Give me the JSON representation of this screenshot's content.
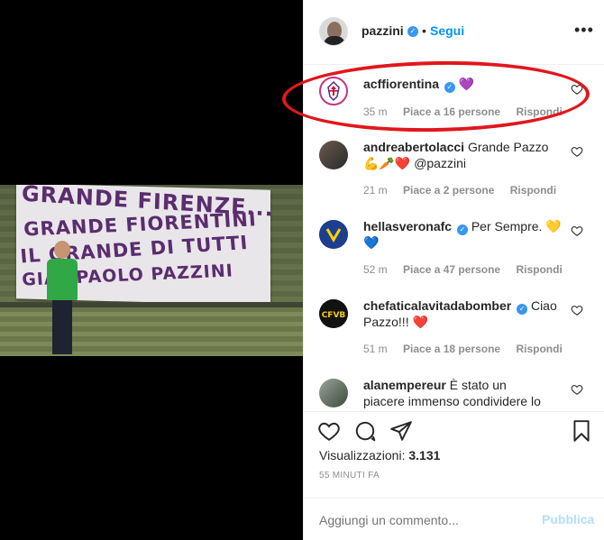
{
  "post": {
    "video_banner_lines": [
      "GRANDE FIRENZE...",
      "GRANDE FIORENTINI",
      "IL GRANDE DI TUTTI",
      "GIAMPAOLO PAZZINI"
    ]
  },
  "header": {
    "username": "pazzini",
    "follow_label": "Segui",
    "more_label": "•••"
  },
  "comments": [
    {
      "username": "acffiorentina",
      "text": "",
      "emoji": "💜",
      "time": "35 m",
      "likes": "Piace a 16 persone",
      "reply": "Rispondi",
      "highlighted": true
    },
    {
      "username": "andreabertolacci",
      "text": "Grande Pazzo",
      "emoji": "💪🥕❤️",
      "mention": "@pazzini",
      "time": "21 m",
      "likes": "Piace a 2 persone",
      "reply": "Rispondi"
    },
    {
      "username": "hellasveronafc",
      "text": "Per Sempre.",
      "emoji": "💛",
      "emoji2": "💙",
      "time": "52 m",
      "likes": "Piace a 47 persone",
      "reply": "Rispondi"
    },
    {
      "username": "chefaticalavitadabomber",
      "text": "Ciao",
      "text2": "Pazzo!!!",
      "emoji": "❤️",
      "time": "51 m",
      "likes": "Piace a 18 persone",
      "reply": "Rispondi"
    },
    {
      "username": "alanempereur",
      "text": "È stato un",
      "text2": "piacere immenso condividere lo",
      "time": "",
      "likes": "",
      "reply": ""
    }
  ],
  "actions": {
    "views_label": "Visualizzazioni:",
    "views_count": "3.131",
    "time_ago": "55 MINUTI FA"
  },
  "add_comment": {
    "placeholder": "Aggiungi un commento...",
    "publish_label": "Pubblica"
  },
  "colors": {
    "accent": "#0095f6",
    "verified": "#3897f0",
    "highlight": "#e0171c",
    "muted": "#8e8e8e"
  }
}
